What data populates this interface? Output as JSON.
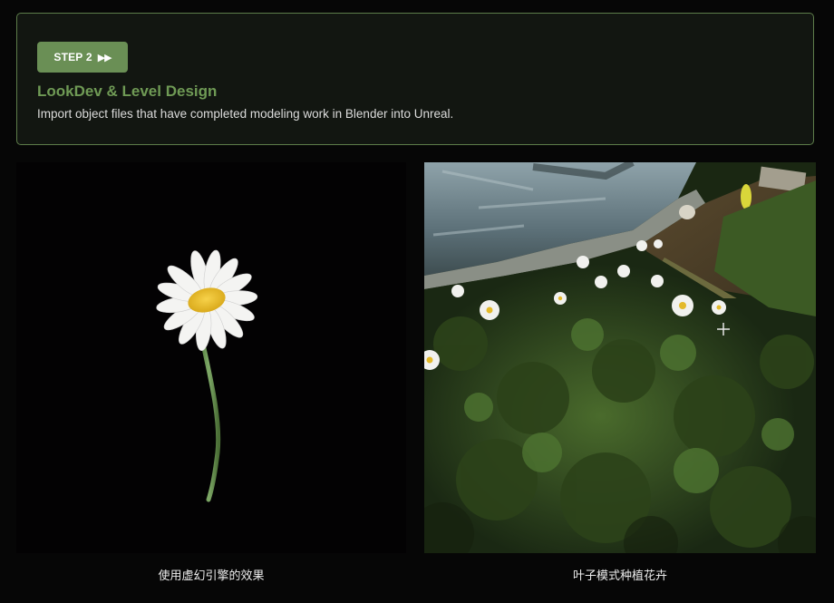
{
  "step": {
    "badge_label": "STEP 2",
    "badge_icon": "double-play-arrows-icon",
    "title": "LookDev & Level Design",
    "description": "Import object files that have completed modeling work in Blender into Unreal."
  },
  "panels": {
    "left_caption": "使用虚幻引擎的效果",
    "right_caption": "叶子模式种植花卉"
  },
  "colors": {
    "accent_green": "#6a8f55",
    "title_green": "#6f9a55",
    "card_border": "#5d7d4a",
    "background": "#060606"
  }
}
